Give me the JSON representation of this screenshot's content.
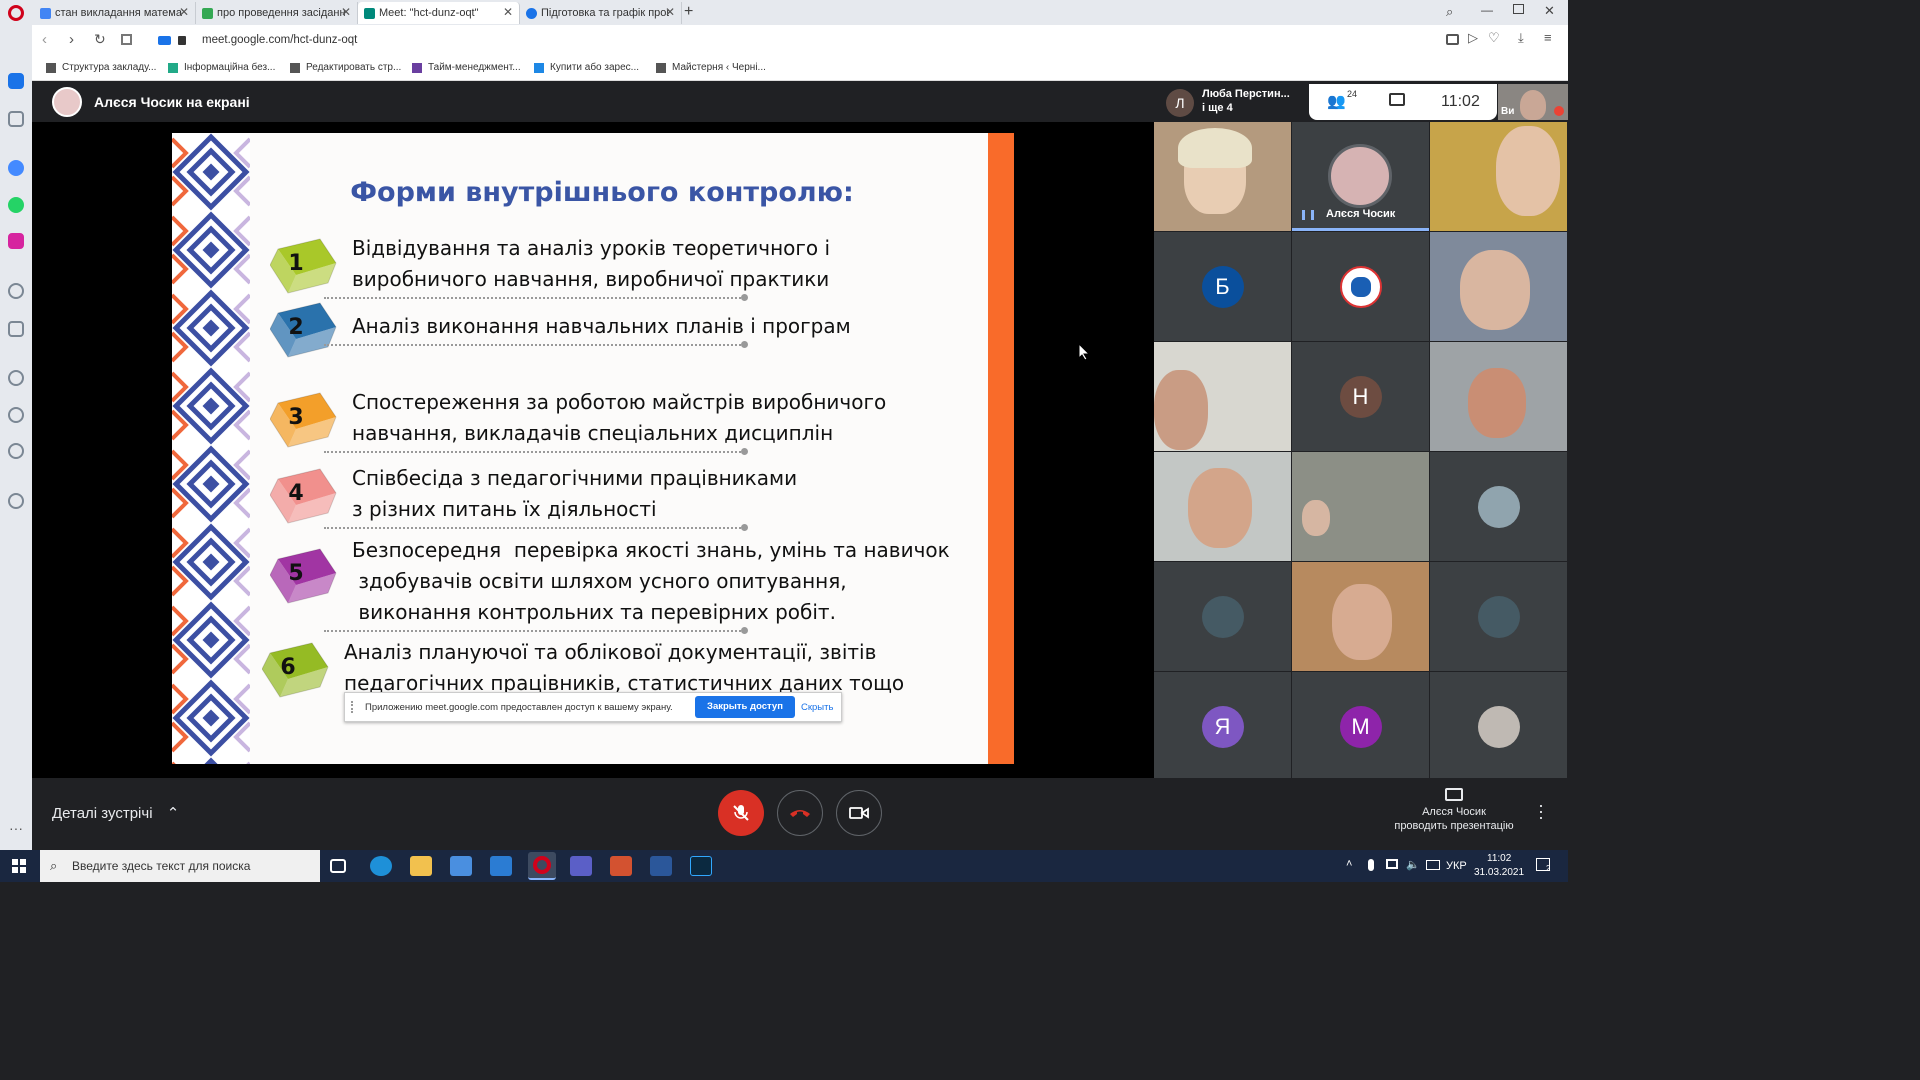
{
  "browser": {
    "tabs": [
      {
        "title": "стан викладання математ",
        "color": "#4285f4"
      },
      {
        "title": "про проведення засідання",
        "color": "#34a853"
      },
      {
        "title": "Meet: \"hct-dunz-oqt\"",
        "color": "#00897b"
      },
      {
        "title": "Підготовка та графік прове",
        "color": "#1a73e8"
      }
    ],
    "url": "meet.google.com/hct-dunz-oqt",
    "bookmarks": [
      "Структура закладу...",
      "Інформаційна без...",
      "Редактировать стр...",
      "Тайм-менеджмент...",
      "Купити або зарес...",
      "Майстерня ‹ Черні..."
    ]
  },
  "meet": {
    "presenter_banner": "Алєся Чосик на екрані",
    "participants_label": "Люба Перстин...",
    "participants_more": "і ще 4",
    "people_count": "24",
    "time": "11:02",
    "self_label": "Ви",
    "speaker_name": "Алєся Чосик",
    "details_label": "Деталі зустрічі",
    "presenting_name": "Алєся Чосик",
    "presenting_status": "проводить презентацію",
    "avatar_letters": {
      "b": "Б",
      "n": "Н",
      "ya": "Я",
      "m": "М",
      "l": "Л"
    }
  },
  "slide": {
    "title": "Форми внутрішнього контролю:",
    "items": [
      {
        "num": "1",
        "color": "#a4c51e",
        "text": "Відвідування та аналіз уроків теоретичного і\nвиробничого навчання, виробничої практики"
      },
      {
        "num": "2",
        "color": "#1f6aa8",
        "text": "Аналіз виконання навчальних планів і програм"
      },
      {
        "num": "3",
        "color": "#f29a1f",
        "text": "Спостереження за роботою майстрів виробничого\nнавчання, викладачів спеціальних дисциплін"
      },
      {
        "num": "4",
        "color": "#f08a87",
        "text": "Співбесіда з педагогічними працівниками\nз різних питань їх діяльності"
      },
      {
        "num": "5",
        "color": "#9c2a9e",
        "text": "Безпосередня  перевірка якості знань, умінь та навичок\n здобувачів освіти шляхом усного опитування,\n виконання контрольних та перевірних робіт."
      },
      {
        "num": "6",
        "color": "#8fb718",
        "text": "Аналіз плануючої та облікової документації, звітів\nпедагогічних працівників, статистичних даних тощо"
      }
    ]
  },
  "share_notice": {
    "text": "Приложению meet.google.com предоставлен доступ к вашему экрану.",
    "stop": "Закрыть доступ",
    "hide": "Скрыть"
  },
  "taskbar": {
    "search_placeholder": "Введите здесь текст для поиска",
    "lang": "УКР",
    "time": "11:02",
    "date": "31.03.2021",
    "notif": "2"
  }
}
